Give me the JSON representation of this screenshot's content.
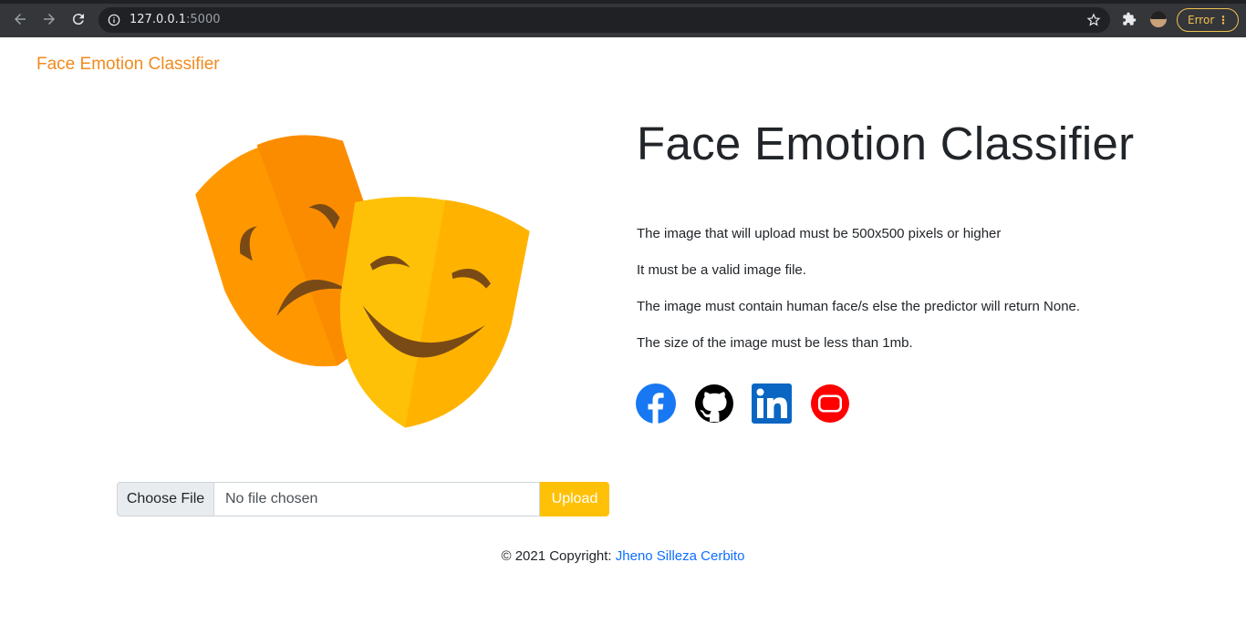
{
  "browser": {
    "url_host": "127.0.0.1",
    "url_port": ":5000",
    "error_label": "Error",
    "menu_glyph": "⋮"
  },
  "navbar": {
    "brand": "Face Emotion Classifier"
  },
  "hero": {
    "title": "Face Emotion Classifier",
    "requirements": [
      "The image that will upload must be 500x500 pixels or higher",
      "It must be a valid image file.",
      "The image must contain human face/s else the predictor will return None.",
      "The size of the image must be less than 1mb."
    ],
    "image_icon": "comedy-tragedy-masks-icon"
  },
  "social": {
    "icons": [
      "facebook-icon",
      "github-icon",
      "linkedin-icon",
      "youtube-icon"
    ],
    "colors": {
      "facebook": "#1877f2",
      "github": "#000000",
      "linkedin": "#0a66c2",
      "youtube": "#ff0000"
    }
  },
  "upload": {
    "choose_label": "Choose File",
    "file_status": "No file chosen",
    "button_label": "Upload"
  },
  "footer": {
    "prefix": "© 2021 Copyright: ",
    "author": "Jheno Silleza Cerbito"
  },
  "colors": {
    "brand": "#f28a1e",
    "upload_button": "#ffc107",
    "link": "#0d6efd"
  }
}
